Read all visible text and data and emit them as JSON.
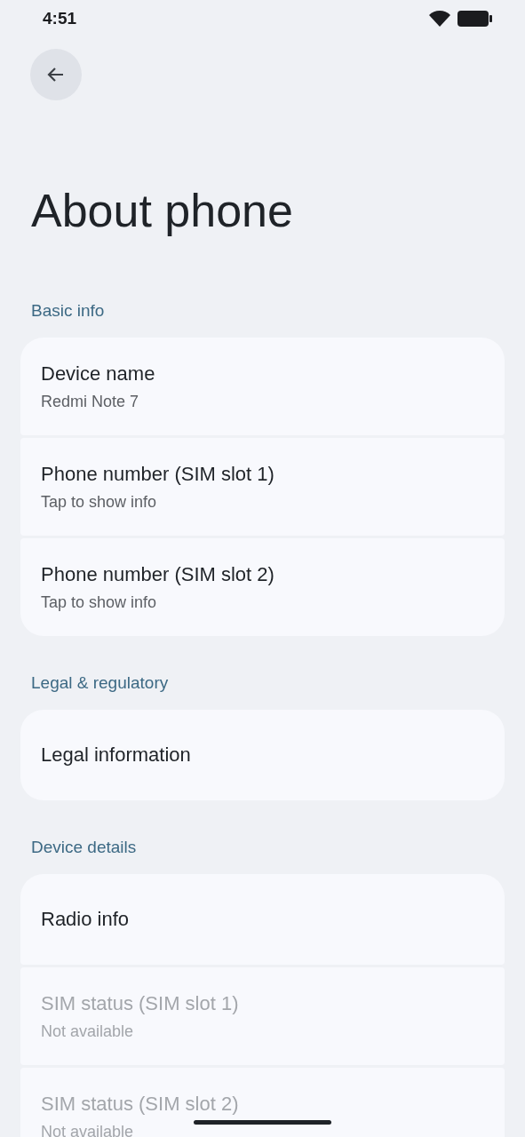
{
  "status_bar": {
    "time": "4:51"
  },
  "title": "About phone",
  "sections": [
    {
      "header": "Basic info",
      "items": [
        {
          "title": "Device name",
          "summary": "Redmi Note 7",
          "disabled": false
        },
        {
          "title": "Phone number (SIM slot 1)",
          "summary": "Tap to show info",
          "disabled": false
        },
        {
          "title": "Phone number (SIM slot 2)",
          "summary": "Tap to show info",
          "disabled": false
        }
      ]
    },
    {
      "header": "Legal & regulatory",
      "items": [
        {
          "title": "Legal information",
          "disabled": false
        }
      ]
    },
    {
      "header": "Device details",
      "items": [
        {
          "title": "Radio info",
          "disabled": false
        },
        {
          "title": "SIM status (SIM slot 1)",
          "summary": "Not available",
          "disabled": true
        },
        {
          "title": "SIM status (SIM slot 2)",
          "summary": "Not available",
          "disabled": true
        }
      ]
    }
  ]
}
